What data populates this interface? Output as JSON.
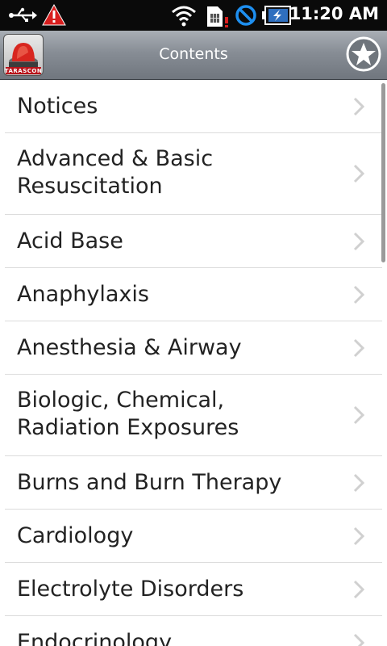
{
  "status_bar": {
    "time": "11:20 AM",
    "icons": [
      "usb-icon",
      "warning-icon",
      "wifi-icon",
      "sim-icon",
      "no-signal-icon",
      "battery-charging-icon"
    ]
  },
  "header": {
    "title": "Contents",
    "logo_text": "TARASCON",
    "favorites_icon": "star-icon"
  },
  "list": {
    "items": [
      {
        "label": "Notices"
      },
      {
        "label": "Advanced & Basic Resuscitation"
      },
      {
        "label": "Acid Base"
      },
      {
        "label": "Anaphylaxis"
      },
      {
        "label": "Anesthesia & Airway"
      },
      {
        "label": "Biologic, Chemical, Radiation Exposures"
      },
      {
        "label": "Burns and Burn Therapy"
      },
      {
        "label": "Cardiology"
      },
      {
        "label": "Electrolyte Disorders"
      },
      {
        "label": "Endocrinology"
      }
    ]
  },
  "colors": {
    "header_top": "#a9aeb5",
    "header_bottom": "#70767e",
    "row_text": "#222222",
    "divider": "#dcdcdc",
    "warning": "#d81e1e",
    "status_blue": "#1e8ff0"
  }
}
